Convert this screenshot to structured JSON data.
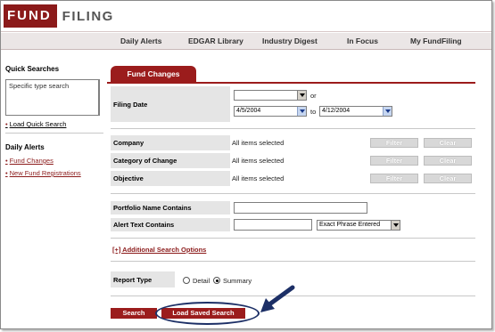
{
  "logo": {
    "part1": "FUND",
    "part2": "FILING"
  },
  "nav": [
    "Daily Alerts",
    "EDGAR Library",
    "Industry Digest",
    "In Focus",
    "My FundFiling"
  ],
  "sidebar": {
    "quick_searches_title": "Quick Searches",
    "quick_search_value": "Specific type search",
    "load_quick_search": "Load Quick Search",
    "daily_alerts_title": "Daily Alerts",
    "links": [
      "Fund Changes",
      "New Fund Registrations"
    ]
  },
  "main": {
    "tab": "Fund Changes",
    "filing_date": {
      "label": "Filing Date",
      "or": "or",
      "from": "4/5/2004",
      "to_label": "to",
      "to": "4/12/2004"
    },
    "filters": [
      {
        "label": "Company",
        "value": "All items selected",
        "filter": "Filter",
        "clear": "Clear"
      },
      {
        "label": "Category of Change",
        "value": "All items selected",
        "filter": "Filter",
        "clear": "Clear"
      },
      {
        "label": "Objective",
        "value": "All items selected",
        "filter": "Filter",
        "clear": "Clear"
      }
    ],
    "portfolio_label": "Portfolio Name Contains",
    "alert_text_label": "Alert Text Contains",
    "phrase_option": "Exact Phrase Entered",
    "additional_search": "[+] Additional Search Options",
    "report_type": {
      "label": "Report Type",
      "detail": "Detail",
      "summary": "Summary",
      "selected": "Summary"
    },
    "search_button": "Search",
    "load_saved_button": "Load Saved Search"
  },
  "colors": {
    "brand": "#9b1c1c",
    "annotation": "#1c2f66"
  }
}
